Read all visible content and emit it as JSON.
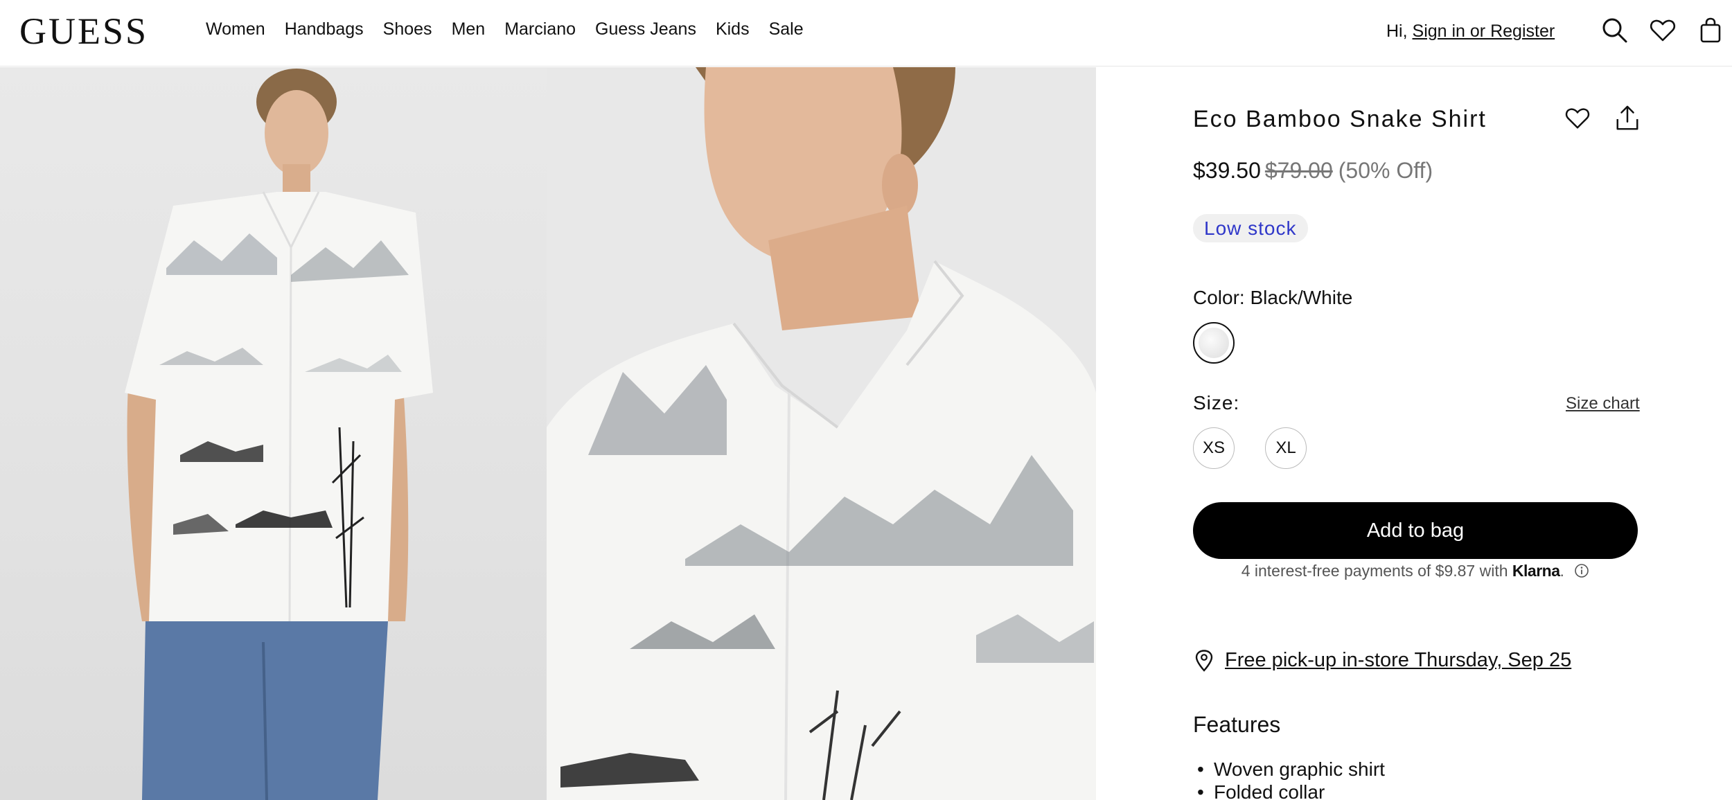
{
  "header": {
    "logo": "GUESS",
    "nav": [
      "Women",
      "Handbags",
      "Shoes",
      "Men",
      "Marciano",
      "Guess Jeans",
      "Kids",
      "Sale"
    ],
    "greeting": "Hi,",
    "signin_link": "Sign in or Register",
    "icons": [
      "search-icon",
      "heart-icon",
      "bag-icon"
    ]
  },
  "product": {
    "title": "Eco Bamboo Snake Shirt",
    "price_now": "$39.50",
    "price_was": "$79.00",
    "discount": "(50% Off)",
    "stock_badge": "Low stock",
    "color_label": "Color: Black/White",
    "size_label": "Size:",
    "size_chart": "Size chart",
    "sizes": [
      "XS",
      "XL"
    ],
    "add_to_bag": "Add to bag",
    "klarna_text": "4 interest-free payments of $9.87 with",
    "klarna_brand": "Klarna",
    "klarna_period": ".",
    "pickup": "Free pick-up in-store Thursday, Sep 25",
    "features_title": "Features",
    "features": [
      "Woven graphic shirt",
      "Folded collar"
    ]
  },
  "colors": {
    "accent_blue": "#2f37c9",
    "button_black": "#000000"
  }
}
